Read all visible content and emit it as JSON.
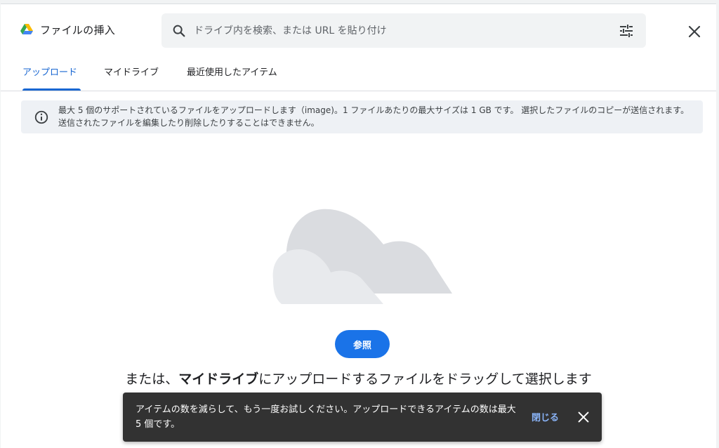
{
  "header": {
    "title": "ファイルの挿入",
    "logo_icon": "google-drive-logo",
    "search_placeholder": "ドライブ内を検索、または URL を貼り付け",
    "search_value": "",
    "filter_icon": "tune-icon",
    "close_icon": "close-icon"
  },
  "tabs": [
    {
      "label": "アップロード",
      "active": true
    },
    {
      "label": "マイドライブ",
      "active": false
    },
    {
      "label": "最近使用したアイテム",
      "active": false
    }
  ],
  "info": {
    "icon": "info-icon",
    "text": "最大 5 個のサポートされているファイルをアップロードします（image)。1 ファイルあたりの最大サイズは 1 GB です。 選択したファイルのコピーが送信されます。送信されたファイルを編集したり削除したりすることはできません。"
  },
  "upload": {
    "illustration": "cloud-illustration",
    "browse_label": "参照",
    "drop_prefix": "または、",
    "drop_emphasis": "マイドライブ",
    "drop_suffix": "にアップロードするファイルをドラッグして選択します"
  },
  "snackbar": {
    "message": "アイテムの数を減らして、もう一度お試しください。アップロードできるアイテムの数は最大 5 個です。",
    "action_label": "閉じる",
    "close_icon": "close-icon"
  },
  "colors": {
    "accent": "#1a73e8",
    "tab_active": "#1967d2",
    "info_bg": "#eef1f5",
    "snackbar_bg": "#323232",
    "snackbar_action": "#8ab4f8"
  }
}
